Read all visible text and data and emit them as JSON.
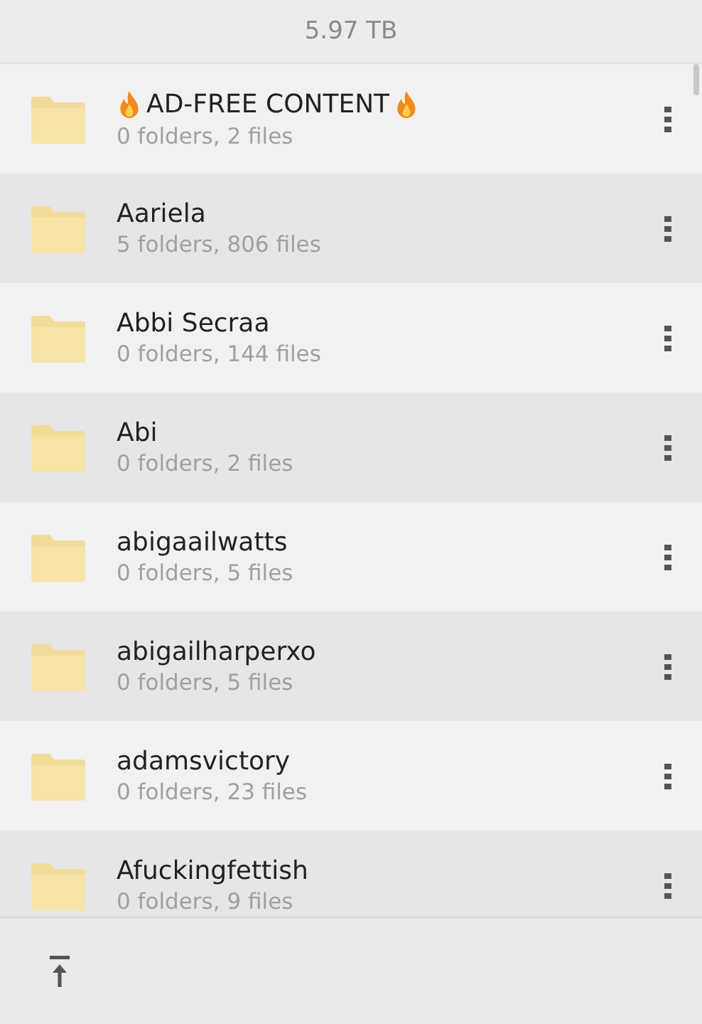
{
  "header": {
    "storage": "5.97 TB"
  },
  "folders": [
    {
      "name": "AD-FREE CONTENT",
      "flame_marked": true,
      "details": "0 folders, 2 files"
    },
    {
      "name": "Aariela",
      "flame_marked": false,
      "details": "5 folders, 806 files"
    },
    {
      "name": "Abbi Secraa",
      "flame_marked": false,
      "details": "0 folders, 144 files"
    },
    {
      "name": "Abi",
      "flame_marked": false,
      "details": "0 folders, 2 files"
    },
    {
      "name": "abigaailwatts",
      "flame_marked": false,
      "details": "0 folders, 5 files"
    },
    {
      "name": "abigailharperxo",
      "flame_marked": false,
      "details": "0 folders, 5 files"
    },
    {
      "name": "adamsvictory",
      "flame_marked": false,
      "details": "0 folders, 23 files"
    },
    {
      "name": "Afuckingfettish",
      "flame_marked": false,
      "details": "0 folders, 9 files"
    }
  ]
}
